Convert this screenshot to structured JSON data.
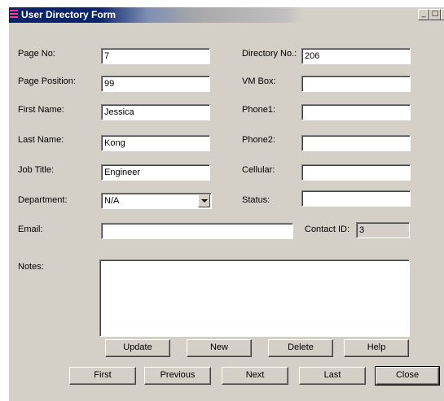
{
  "window": {
    "title": "User Directory Form",
    "minimize_glyph": "_",
    "maximize_glyph": "□",
    "close_glyph": "x"
  },
  "form": {
    "page_no": {
      "label": "Page No:",
      "value": "7"
    },
    "page_position": {
      "label": "Page Position:",
      "value": "99"
    },
    "first_name": {
      "label": "First Name:",
      "value": "Jessica"
    },
    "last_name": {
      "label": "Last Name:",
      "value": "Kong"
    },
    "job_title": {
      "label": "Job Title:",
      "value": "Engineer"
    },
    "department": {
      "label": "Department:",
      "value": "N/A"
    },
    "email": {
      "label": "Email:",
      "value": ""
    },
    "notes": {
      "label": "Notes:",
      "value": ""
    },
    "directory_no": {
      "label": "Directory No.:",
      "value": "206"
    },
    "vm_box": {
      "label": "VM Box:",
      "value": ""
    },
    "phone1": {
      "label": "Phone1:",
      "value": ""
    },
    "phone2": {
      "label": "Phone2:",
      "value": ""
    },
    "cellular": {
      "label": "Cellular:",
      "value": ""
    },
    "status": {
      "label": "Status:",
      "value": ""
    },
    "contact_id": {
      "label": "Contact ID:",
      "value": "3"
    }
  },
  "buttons": {
    "update": "Update",
    "new": "New",
    "delete": "Delete",
    "help": "Help",
    "first": "First",
    "previous": "Previous",
    "next": "Next",
    "last": "Last",
    "close": "Close"
  },
  "icons": {
    "app": "user-directory-app-icon",
    "dropdown": "chevron-down-icon"
  }
}
